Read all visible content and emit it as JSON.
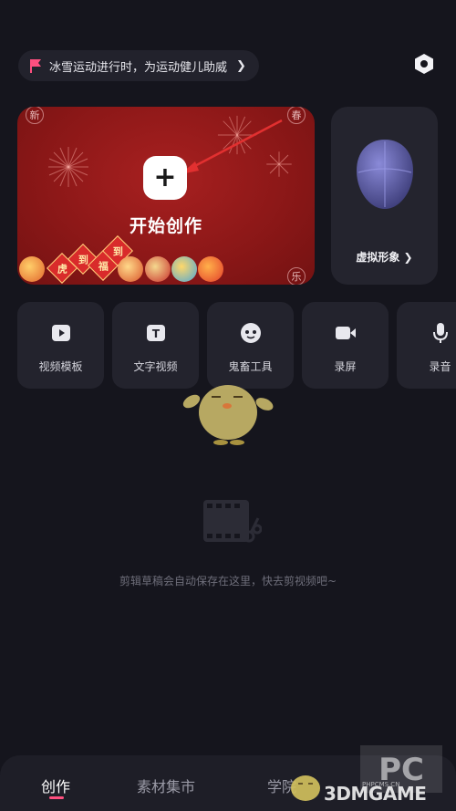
{
  "banner": {
    "text": "冰雪运动进行时，为运动健儿助威",
    "chevron": "❯",
    "icon": "flag-icon",
    "icon_color": "#ff4f7f"
  },
  "header": {
    "settings_icon": "settings-hexagon-icon"
  },
  "create_card": {
    "title": "开始创作",
    "plus": "+",
    "corners": [
      "新",
      "春",
      "乐"
    ],
    "tags": [
      "虎",
      "到",
      "福",
      "到"
    ],
    "accent": "#9b1c1c"
  },
  "avatar_card": {
    "label": "虚拟形象 ❯"
  },
  "tools": [
    {
      "label": "视频模板",
      "icon": "video-template-icon"
    },
    {
      "label": "文字视频",
      "icon": "text-video-icon"
    },
    {
      "label": "鬼畜工具",
      "icon": "remix-tool-icon"
    },
    {
      "label": "录屏",
      "icon": "screen-record-icon"
    },
    {
      "label": "录音",
      "icon": "microphone-icon"
    }
  ],
  "empty_state": {
    "text": "剪辑草稿会自动保存在这里，快去剪视频吧~",
    "icon": "film-scissors-icon"
  },
  "bottom_nav": {
    "items": [
      {
        "label": "创作",
        "active": true
      },
      {
        "label": "素材集市",
        "active": false
      },
      {
        "label": "学院",
        "active": false
      }
    ],
    "underline_color": "#ff4f7f"
  },
  "watermark": {
    "text": "3DMGAME",
    "small": "PHPCMS.CN"
  }
}
